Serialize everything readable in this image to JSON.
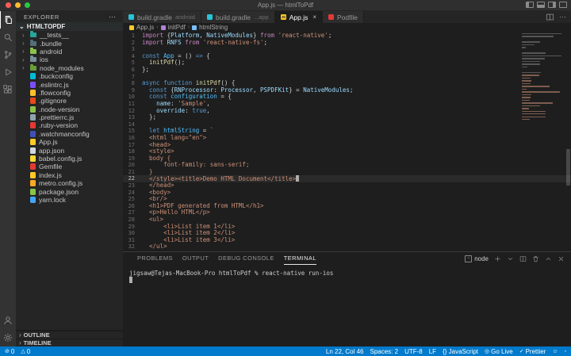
{
  "window": {
    "title": "App.js — htmlToPdf"
  },
  "activity_bar": {
    "items": [
      {
        "icon": "files-icon",
        "active": true
      },
      {
        "icon": "search-icon",
        "active": false
      },
      {
        "icon": "source-control-icon",
        "active": false
      },
      {
        "icon": "run-debug-icon",
        "active": false
      },
      {
        "icon": "extensions-icon",
        "active": false
      }
    ],
    "bottom": [
      {
        "icon": "account-icon"
      },
      {
        "icon": "settings-gear-icon"
      }
    ]
  },
  "sidebar": {
    "header": "EXPLORER",
    "more_label": "⋯",
    "root": "HTMLTOPDF",
    "items": [
      {
        "label": "__tests__",
        "kind": "folder",
        "color": "#26a69a"
      },
      {
        "label": ".bundle",
        "kind": "folder",
        "color": "#546e7a"
      },
      {
        "label": "android",
        "kind": "folder",
        "color": "#8bc34a"
      },
      {
        "label": "ios",
        "kind": "folder",
        "color": "#78909c"
      },
      {
        "label": "node_modules",
        "kind": "folder",
        "color": "#689f38"
      },
      {
        "label": ".buckconfig",
        "kind": "file",
        "color": "#00bcd4"
      },
      {
        "label": ".eslintrc.js",
        "kind": "file",
        "color": "#7c4dff"
      },
      {
        "label": ".flowconfig",
        "kind": "file",
        "color": "#fbc02d"
      },
      {
        "label": ".gitignore",
        "kind": "file",
        "color": "#e64a19"
      },
      {
        "label": ".node-version",
        "kind": "file",
        "color": "#8bc34a"
      },
      {
        "label": ".prettierrc.js",
        "kind": "file",
        "color": "#90a4ae"
      },
      {
        "label": ".ruby-version",
        "kind": "file",
        "color": "#e53935"
      },
      {
        "label": ".watchmanconfig",
        "kind": "file",
        "color": "#3f51b5"
      },
      {
        "label": "App.js",
        "kind": "file",
        "color": "#ffca28"
      },
      {
        "label": "app.json",
        "kind": "file",
        "color": "#cfd8dc"
      },
      {
        "label": "babel.config.js",
        "kind": "file",
        "color": "#fdd835"
      },
      {
        "label": "Gemfile",
        "kind": "file",
        "color": "#e53935"
      },
      {
        "label": "index.js",
        "kind": "file",
        "color": "#ffca28"
      },
      {
        "label": "metro.config.js",
        "kind": "file",
        "color": "#ffa726"
      },
      {
        "label": "package.json",
        "kind": "file",
        "color": "#8bc34a"
      },
      {
        "label": "yarn.lock",
        "kind": "file",
        "color": "#42a5f5"
      }
    ],
    "bottom_sections": [
      "OUTLINE",
      "TIMELINE"
    ]
  },
  "tabs": [
    {
      "label": "build.gradle",
      "detail": "android",
      "icon_color": "#26c6da",
      "icon_text": "",
      "active": false
    },
    {
      "label": "build.gradle",
      "detail": "...app",
      "icon_color": "#26c6da",
      "icon_text": "",
      "active": false
    },
    {
      "label": "App.js",
      "detail": "",
      "icon_color": "#ffca28",
      "icon_text": "JS",
      "active": true,
      "close_label": "×"
    },
    {
      "label": "Podfile",
      "detail": "",
      "icon_color": "#e53935",
      "icon_text": "",
      "active": false
    }
  ],
  "breadcrumb": {
    "items": [
      {
        "label": "App.js",
        "icon_color": "#ffca28"
      },
      {
        "label": "initPdf",
        "icon_color": "#b180d7"
      },
      {
        "label": "htmlString",
        "icon_color": "#75beff"
      }
    ],
    "separator": "›"
  },
  "editor": {
    "active_line": 22,
    "cursor_position": "Ln 22, Col 46",
    "lines": [
      {
        "n": 1,
        "s": [
          [
            "kw",
            "import "
          ],
          [
            "pun",
            "{"
          ],
          [
            "var",
            "Platform"
          ],
          [
            "pun",
            ", "
          ],
          [
            "var",
            "NativeModules"
          ],
          [
            "pun",
            "} "
          ],
          [
            "kw",
            "from "
          ],
          [
            "str",
            "'react-native'"
          ],
          [
            "pun",
            ";"
          ]
        ]
      },
      {
        "n": 2,
        "s": [
          [
            "kw",
            "import "
          ],
          [
            "var",
            "RNFS"
          ],
          [
            "kw",
            " from "
          ],
          [
            "str",
            "'react-native-fs'"
          ],
          [
            "pun",
            ";"
          ]
        ]
      },
      {
        "n": 3,
        "s": []
      },
      {
        "n": 4,
        "s": [
          [
            "kw2",
            "const "
          ],
          [
            "cls",
            "App"
          ],
          [
            "pun",
            " = () "
          ],
          [
            "kw2",
            "=>"
          ],
          [
            "pun",
            " {"
          ]
        ]
      },
      {
        "n": 5,
        "s": [
          [
            "pun",
            "  "
          ],
          [
            "fn",
            "initPdf"
          ],
          [
            "pun",
            "();"
          ]
        ]
      },
      {
        "n": 6,
        "s": [
          [
            "pun",
            "};"
          ]
        ]
      },
      {
        "n": 7,
        "s": []
      },
      {
        "n": 8,
        "s": [
          [
            "kw2",
            "async function "
          ],
          [
            "fn",
            "initPdf"
          ],
          [
            "pun",
            "() {"
          ]
        ]
      },
      {
        "n": 9,
        "s": [
          [
            "pun",
            "  "
          ],
          [
            "kw2",
            "const "
          ],
          [
            "pun",
            "{"
          ],
          [
            "var",
            "RNProcessor"
          ],
          [
            "pun",
            ": "
          ],
          [
            "var",
            "Processor"
          ],
          [
            "pun",
            ", "
          ],
          [
            "var",
            "PSPDFKit"
          ],
          [
            "pun",
            "} = "
          ],
          [
            "var",
            "NativeModules"
          ],
          [
            "pun",
            ";"
          ]
        ]
      },
      {
        "n": 10,
        "s": [
          [
            "pun",
            "  "
          ],
          [
            "kw2",
            "const "
          ],
          [
            "cls",
            "configuration"
          ],
          [
            "pun",
            " = {"
          ]
        ]
      },
      {
        "n": 11,
        "s": [
          [
            "pun",
            "    "
          ],
          [
            "var",
            "name"
          ],
          [
            "pun",
            ": "
          ],
          [
            "str",
            "'Sample'"
          ],
          [
            "pun",
            ","
          ]
        ]
      },
      {
        "n": 12,
        "s": [
          [
            "pun",
            "    "
          ],
          [
            "var",
            "override"
          ],
          [
            "pun",
            ": "
          ],
          [
            "kw2",
            "true"
          ],
          [
            "pun",
            ","
          ]
        ]
      },
      {
        "n": 13,
        "s": [
          [
            "pun",
            "  };"
          ]
        ]
      },
      {
        "n": 14,
        "s": []
      },
      {
        "n": 15,
        "s": [
          [
            "pun",
            "  "
          ],
          [
            "kw2",
            "let "
          ],
          [
            "cls",
            "htmlString"
          ],
          [
            "pun",
            " = "
          ],
          [
            "str",
            "`"
          ]
        ]
      },
      {
        "n": 16,
        "s": [
          [
            "str",
            "  <html lang=\"en\">"
          ]
        ]
      },
      {
        "n": 17,
        "s": [
          [
            "str",
            "  <head>"
          ]
        ]
      },
      {
        "n": 18,
        "s": [
          [
            "str",
            "  <style>"
          ]
        ]
      },
      {
        "n": 19,
        "s": [
          [
            "str",
            "  body {"
          ]
        ]
      },
      {
        "n": 20,
        "s": [
          [
            "str",
            "      font-family: sans-serif;"
          ]
        ]
      },
      {
        "n": 21,
        "s": [
          [
            "str",
            "  }"
          ]
        ]
      },
      {
        "n": 22,
        "s": [
          [
            "str",
            "  </style><title>Demo HTML Document</title>"
          ]
        ]
      },
      {
        "n": 23,
        "s": [
          [
            "str",
            "  </head>"
          ]
        ]
      },
      {
        "n": 24,
        "s": [
          [
            "str",
            "  <body>"
          ]
        ]
      },
      {
        "n": 25,
        "s": [
          [
            "str",
            "  <br/>"
          ]
        ]
      },
      {
        "n": 26,
        "s": [
          [
            "str",
            "  <h1>PDF generated from HTML</h1>"
          ]
        ]
      },
      {
        "n": 27,
        "s": [
          [
            "str",
            "  <p>Hello HTML</p>"
          ]
        ]
      },
      {
        "n": 28,
        "s": [
          [
            "str",
            "  <ul>"
          ]
        ]
      },
      {
        "n": 29,
        "s": [
          [
            "str",
            "      <li>List item 1</li>"
          ]
        ]
      },
      {
        "n": 30,
        "s": [
          [
            "str",
            "      <li>List item 2</li>"
          ]
        ]
      },
      {
        "n": 31,
        "s": [
          [
            "str",
            "      <li>List item 3</li>"
          ]
        ]
      },
      {
        "n": 32,
        "s": [
          [
            "str",
            "  </ul>"
          ]
        ]
      }
    ]
  },
  "panel": {
    "tabs": [
      "PROBLEMS",
      "OUTPUT",
      "DEBUG CONSOLE",
      "TERMINAL"
    ],
    "active_tab": "TERMINAL",
    "shell_label": "node",
    "shell_icon_glyph": "›",
    "action_icons": [
      "plus-icon",
      "chevron-down-icon",
      "split-terminal-icon",
      "trash-icon",
      "chevron-up-icon",
      "close-icon"
    ],
    "terminal_prompt": "jigsaw@Tejas-MacBook-Pro htmlToPdf % react-native run-ios"
  },
  "status_bar": {
    "left": [
      {
        "icon": "error-circle-icon",
        "glyph": "⊘",
        "label": "0"
      },
      {
        "icon": "warning-icon",
        "glyph": "△",
        "label": "0"
      }
    ],
    "right": [
      {
        "label": "Ln 22, Col 46"
      },
      {
        "label": "Spaces: 2"
      },
      {
        "label": "UTF-8"
      },
      {
        "label": "LF"
      },
      {
        "label": "{} JavaScript"
      },
      {
        "icon": "broadcast-icon",
        "glyph": "◎",
        "label": "Go Live"
      },
      {
        "icon": "check-icon",
        "glyph": "✓",
        "label": "Prettier"
      }
    ],
    "trailing_icons": [
      {
        "icon": "feedback-icon",
        "glyph": "☺"
      },
      {
        "icon": "bell-icon",
        "glyph": "◦"
      }
    ],
    "accent_color": "#007acc"
  }
}
